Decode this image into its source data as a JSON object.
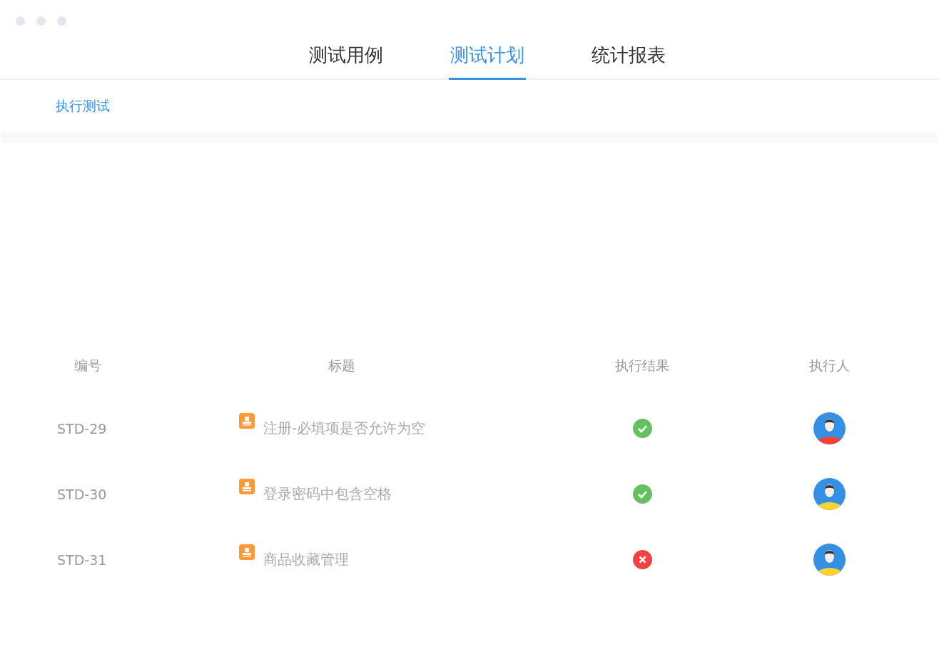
{
  "tabs": [
    {
      "label": "测试用例",
      "selected": false
    },
    {
      "label": "测试计划",
      "selected": true
    },
    {
      "label": "统计报表",
      "selected": false
    }
  ],
  "subnav": {
    "label": "执行测试"
  },
  "table": {
    "columns": [
      "编号",
      "标题",
      "执行结果",
      "执行人"
    ],
    "rows": [
      {
        "id": "STD-29",
        "title": "注册-必填项是否允许为空",
        "result": {
          "kind": "pass"
        },
        "executor": {
          "color": "#f44336"
        }
      },
      {
        "id": "STD-30",
        "title": "登录密码中包含空格",
        "result": {
          "kind": "pass"
        },
        "executor": {
          "color": "#fdd12f"
        }
      },
      {
        "id": "STD-31",
        "title": "商品收藏管理",
        "result": {
          "kind": "fail"
        },
        "executor": {
          "color": "#fdd12f"
        }
      }
    ]
  }
}
